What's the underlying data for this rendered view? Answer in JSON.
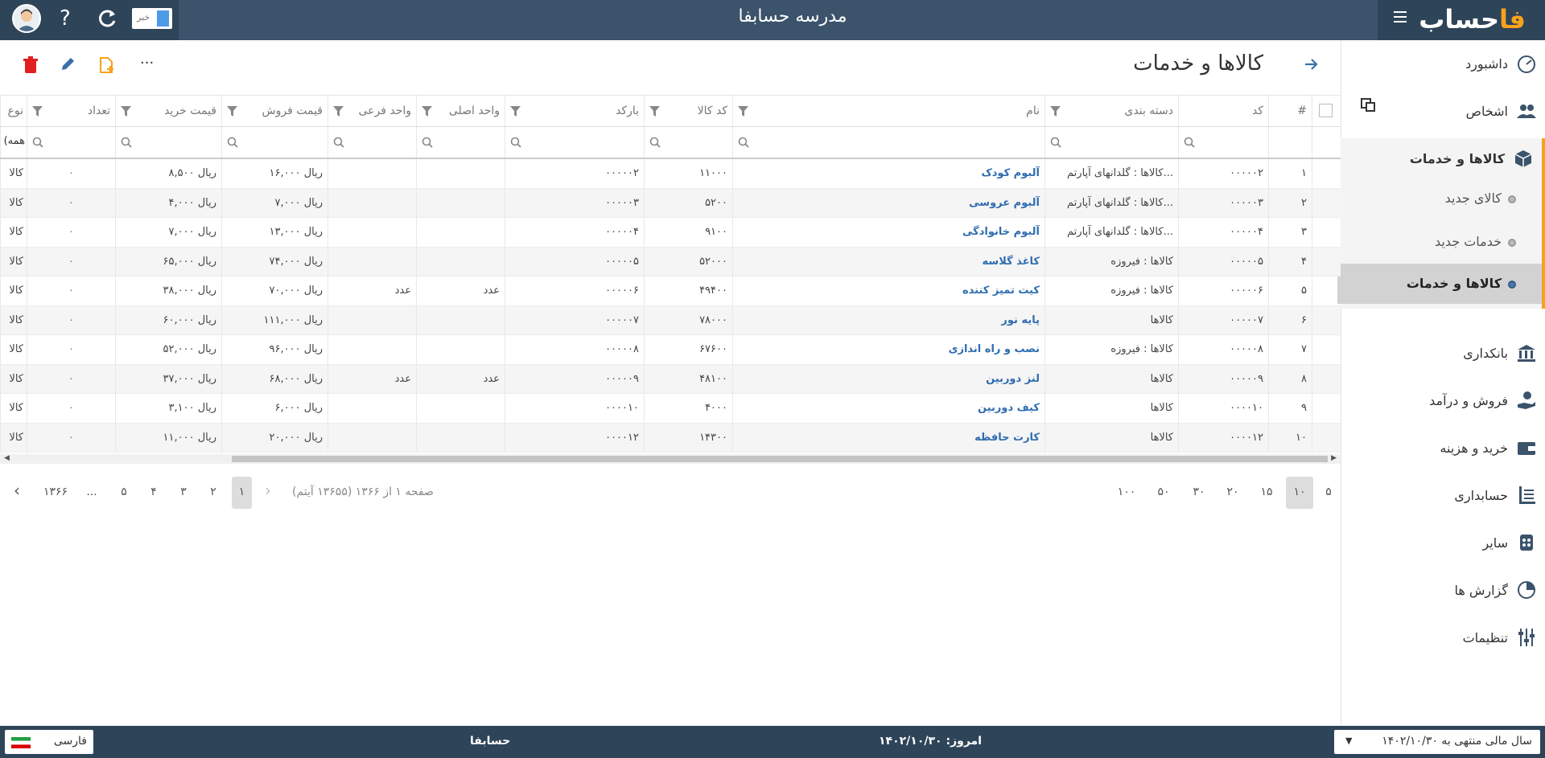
{
  "topbar": {
    "title": "مدرسه حسابفا",
    "news_label": "خبر",
    "logo_main": "حساب",
    "logo_accent": "فا",
    "help_icon": "question-icon",
    "refresh_icon": "refresh-icon"
  },
  "sidebar": {
    "items": [
      {
        "label": "داشبورد",
        "icon": "speedometer-icon"
      },
      {
        "label": "اشخاص",
        "icon": "people-icon"
      },
      {
        "label": "کالاها و خدمات",
        "icon": "box-icon"
      },
      {
        "label": "بانکداری",
        "icon": "bank-icon"
      },
      {
        "label": "فروش و درآمد",
        "icon": "hand-money-icon"
      },
      {
        "label": "خرید و هزینه",
        "icon": "wallet-icon"
      },
      {
        "label": "حسابداری",
        "icon": "ledger-icon"
      },
      {
        "label": "سایر",
        "icon": "grid-icon"
      },
      {
        "label": "گزارش ها",
        "icon": "pie-chart-icon"
      },
      {
        "label": "تنظیمات",
        "icon": "sliders-icon"
      }
    ],
    "sub": [
      {
        "label": "کالای جدید"
      },
      {
        "label": "خدمات جدید"
      },
      {
        "label": "کالاها و خدمات"
      }
    ]
  },
  "page": {
    "title": "کالاها و خدمات",
    "more": "···"
  },
  "grid": {
    "headers": [
      "#",
      "کد",
      "دسته بندی",
      "نام",
      "کد کالا",
      "بارکد",
      "واحد اصلی",
      "واحد فرعی",
      "قیمت فروش",
      "قیمت خرید",
      "تعداد",
      "نوع"
    ],
    "filter_type_value": "(همه",
    "rows": [
      [
        "۱",
        "۰۰۰۰۰۲",
        "کالاها : گلدانهای آپارتم...",
        "آلبوم کودک",
        "۱۱۰۰۰",
        "۰۰۰۰۰۲",
        "",
        "",
        "ریال ۱۶,۰۰۰",
        "ریال ۸,۵۰۰",
        "۰",
        "کالا"
      ],
      [
        "۲",
        "۰۰۰۰۰۳",
        "کالاها : گلدانهای آپارتم...",
        "آلبوم عروسی",
        "۵۲۰۰",
        "۰۰۰۰۰۳",
        "",
        "",
        "ریال ۷,۰۰۰",
        "ریال ۴,۰۰۰",
        "۰",
        "کالا"
      ],
      [
        "۳",
        "۰۰۰۰۰۴",
        "کالاها : گلدانهای آپارتم...",
        "آلبوم خانوادگی",
        "۹۱۰۰",
        "۰۰۰۰۰۴",
        "",
        "",
        "ریال ۱۳,۰۰۰",
        "ریال ۷,۰۰۰",
        "۰",
        "کالا"
      ],
      [
        "۴",
        "۰۰۰۰۰۵",
        "کالاها : فیروزه",
        "کاغذ گلاسه",
        "۵۲۰۰۰",
        "۰۰۰۰۰۵",
        "",
        "",
        "ریال ۷۴,۰۰۰",
        "ریال ۶۵,۰۰۰",
        "۰",
        "کالا"
      ],
      [
        "۵",
        "۰۰۰۰۰۶",
        "کالاها : فیروزه",
        "کیت تمیز کننده",
        "۴۹۴۰۰",
        "۰۰۰۰۰۶",
        "عدد",
        "عدد",
        "ریال ۷۰,۰۰۰",
        "ریال ۳۸,۰۰۰",
        "۰",
        "کالا"
      ],
      [
        "۶",
        "۰۰۰۰۰۷",
        "کالاها",
        "پایه نور",
        "۷۸۰۰۰",
        "۰۰۰۰۰۷",
        "",
        "",
        "ریال ۱۱۱,۰۰۰",
        "ریال ۶۰,۰۰۰",
        "۰",
        "کالا"
      ],
      [
        "۷",
        "۰۰۰۰۰۸",
        "کالاها : فیروزه",
        "نصب و راه اندازی",
        "۶۷۶۰۰",
        "۰۰۰۰۰۸",
        "",
        "",
        "ریال ۹۶,۰۰۰",
        "ریال ۵۲,۰۰۰",
        "۰",
        "کالا"
      ],
      [
        "۸",
        "۰۰۰۰۰۹",
        "کالاها",
        "لنز دوربین",
        "۴۸۱۰۰",
        "۰۰۰۰۰۹",
        "عدد",
        "عدد",
        "ریال ۶۸,۰۰۰",
        "ریال ۳۷,۰۰۰",
        "۰",
        "کالا"
      ],
      [
        "۹",
        "۰۰۰۰۱۰",
        "کالاها",
        "کیف دوربین",
        "۴۰۰۰",
        "۰۰۰۰۱۰",
        "",
        "",
        "ریال ۶,۰۰۰",
        "ریال ۳,۱۰۰",
        "۰",
        "کالا"
      ],
      [
        "۱۰",
        "۰۰۰۰۱۲",
        "کالاها",
        "کارت حافظه",
        "۱۴۳۰۰",
        "۰۰۰۰۱۲",
        "",
        "",
        "ریال ۲۰,۰۰۰",
        "ریال ۱۱,۰۰۰",
        "۰",
        "کالا"
      ]
    ]
  },
  "pager": {
    "sizes": [
      "۵",
      "۱۰",
      "۱۵",
      "۲۰",
      "۳۰",
      "۵۰",
      "۱۰۰"
    ],
    "selected_size": "۱۰",
    "info": "صفحه ۱ از ۱۳۶۶ (۱۳۶۵۵ آیتم)",
    "pages": [
      "۱",
      "۲",
      "۳",
      "۴",
      "۵",
      "...",
      "۱۳۶۶"
    ],
    "current_page": "۱"
  },
  "footer": {
    "language": "فارسی",
    "company": "حسابفا",
    "today": "امروز: ۱۴۰۲/۱۰/۳۰",
    "fiscal_year": "سال مالی منتهی به ۱۴۰۲/۱۰/۳۰"
  },
  "colors": {
    "topbar": "#3b536b",
    "topbar_dark": "#2e4459",
    "accent": "#f7a21b",
    "link": "#2f6db0",
    "delete": "#e02020"
  }
}
